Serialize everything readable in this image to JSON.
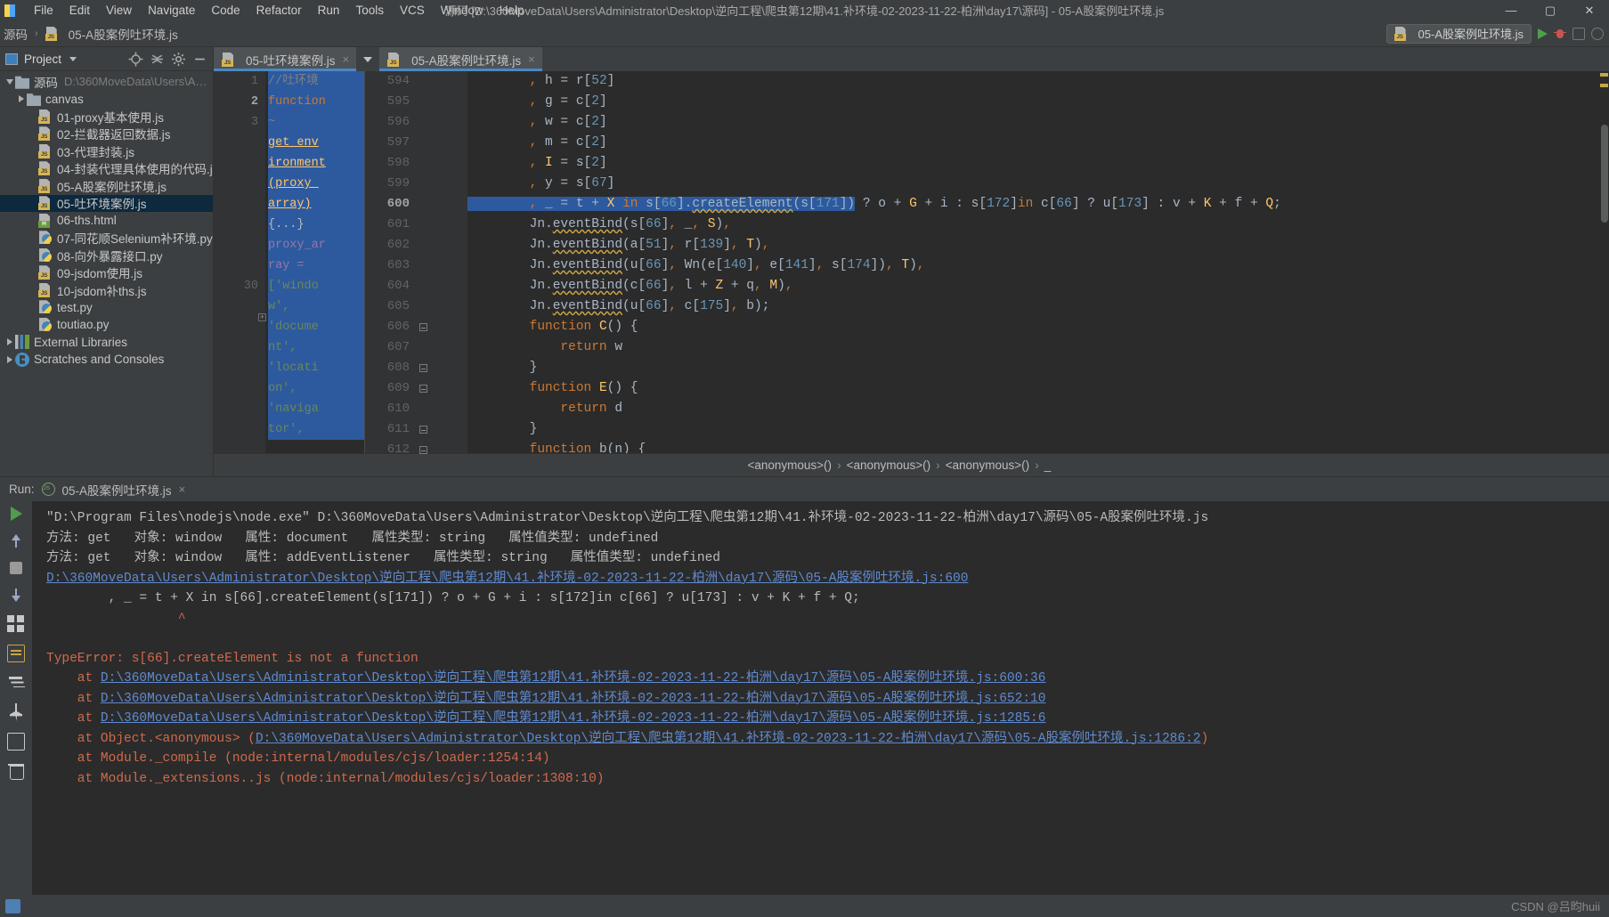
{
  "window": {
    "title": "源码 [D:\\360MoveData\\Users\\Administrator\\Desktop\\逆向工程\\爬虫第12期\\41.补环境-02-2023-11-22-柏洲\\day17\\源码] - 05-A股案例吐环境.js",
    "minimize": "—",
    "maximize": "▢",
    "close": "✕"
  },
  "menu": [
    "File",
    "Edit",
    "View",
    "Navigate",
    "Code",
    "Refactor",
    "Run",
    "Tools",
    "VCS",
    "Window",
    "Help"
  ],
  "breadcrumb": {
    "root": "源码",
    "separator": "›",
    "file": "05-A股案例吐环境.js"
  },
  "run_config": {
    "name": "05-A股案例吐环境.js",
    "run_icon": "run-icon",
    "debug_icon": "debug-icon",
    "coverage_icon": "coverage-icon",
    "profile_icon": "profile-icon"
  },
  "sidebar": {
    "title": "Project",
    "chevron": "▾",
    "toolbar_icons": [
      "locate-icon",
      "collapse-all-icon",
      "settings-gear-icon",
      "hide-icon"
    ],
    "tree": [
      {
        "label": "源码",
        "path": "D:\\360MoveData\\Users\\A…",
        "type": "folder",
        "depth": 0,
        "expanded": true,
        "selected": false
      },
      {
        "label": "canvas",
        "path": "",
        "type": "folder",
        "depth": 1,
        "expanded": false,
        "selected": false
      },
      {
        "label": "01-proxy基本使用.js",
        "path": "",
        "type": "js",
        "depth": 2,
        "expanded": null,
        "selected": false
      },
      {
        "label": "02-拦截器返回数据.js",
        "path": "",
        "type": "js",
        "depth": 2,
        "expanded": null,
        "selected": false
      },
      {
        "label": "03-代理封装.js",
        "path": "",
        "type": "js",
        "depth": 2,
        "expanded": null,
        "selected": false
      },
      {
        "label": "04-封装代理具体使用的代码.js",
        "path": "",
        "type": "js",
        "depth": 2,
        "expanded": null,
        "selected": false
      },
      {
        "label": "05-A股案例吐环境.js",
        "path": "",
        "type": "js",
        "depth": 2,
        "expanded": null,
        "selected": false
      },
      {
        "label": "05-吐环境案例.js",
        "path": "",
        "type": "js",
        "depth": 2,
        "expanded": null,
        "selected": true
      },
      {
        "label": "06-ths.html",
        "path": "",
        "type": "html",
        "depth": 2,
        "expanded": null,
        "selected": false
      },
      {
        "label": "07-同花顺Selenium补环境.py",
        "path": "",
        "type": "py",
        "depth": 2,
        "expanded": null,
        "selected": false
      },
      {
        "label": "08-向外暴露接口.py",
        "path": "",
        "type": "py",
        "depth": 2,
        "expanded": null,
        "selected": false
      },
      {
        "label": "09-jsdom使用.js",
        "path": "",
        "type": "js",
        "depth": 2,
        "expanded": null,
        "selected": false
      },
      {
        "label": "10-jsdom补ths.js",
        "path": "",
        "type": "js",
        "depth": 2,
        "expanded": null,
        "selected": false
      },
      {
        "label": "test.py",
        "path": "",
        "type": "py",
        "depth": 2,
        "expanded": null,
        "selected": false
      },
      {
        "label": "toutiao.py",
        "path": "",
        "type": "py",
        "depth": 2,
        "expanded": null,
        "selected": false
      },
      {
        "label": "External Libraries",
        "path": "",
        "type": "lib",
        "depth": 0,
        "expanded": false,
        "selected": false
      },
      {
        "label": "Scratches and Consoles",
        "path": "",
        "type": "scratch",
        "depth": 0,
        "expanded": false,
        "selected": false
      }
    ]
  },
  "editor_tabs": [
    {
      "label": "05-吐环境案例.js",
      "type": "js",
      "active": true,
      "close": "×"
    },
    {
      "label": "05-A股案例吐环境.js",
      "type": "js",
      "active": true,
      "close": "×"
    }
  ],
  "left_editor": {
    "line_numbers": [
      "1",
      "2",
      "3",
      "",
      "",
      "",
      "",
      "",
      "",
      "",
      "30",
      "",
      "",
      "",
      "",
      "",
      "",
      ""
    ],
    "lines": [
      "//吐环境",
      "function",
      "~",
      "get_env",
      "ironment",
      "(proxy_",
      "array)",
      "{...}",
      "proxy_ar",
      "ray =",
      "['windo",
      "w',",
      "'docume",
      "nt',",
      "'locati",
      "on',",
      "'naviga",
      "tor',"
    ]
  },
  "right_editor": {
    "lines": [
      {
        "num": "594",
        "text": ", h = r[52]"
      },
      {
        "num": "595",
        "text": ", g = c[2]"
      },
      {
        "num": "596",
        "text": ", w = c[2]"
      },
      {
        "num": "597",
        "text": ", m = c[2]"
      },
      {
        "num": "598",
        "text": ", I = s[2]"
      },
      {
        "num": "599",
        "text": ", y = s[67]"
      },
      {
        "num": "600",
        "text": ", _ = t + X in s[66].createElement(s[171]) ? o + G + i : s[172]in c[66] ? u[173] : v + K + f + Q;"
      },
      {
        "num": "601",
        "text": "Jn.eventBind(s[66], _, S),"
      },
      {
        "num": "602",
        "text": "Jn.eventBind(a[51], r[139], T),"
      },
      {
        "num": "603",
        "text": "Jn.eventBind(u[66], Wn(e[140], e[141], s[174]), T),"
      },
      {
        "num": "604",
        "text": "Jn.eventBind(c[66], l + Z + q, M),"
      },
      {
        "num": "605",
        "text": "Jn.eventBind(u[66], c[175], b);"
      },
      {
        "num": "606",
        "text": "function C() {"
      },
      {
        "num": "607",
        "text": "    return w"
      },
      {
        "num": "608",
        "text": "}"
      },
      {
        "num": "609",
        "text": "function E() {"
      },
      {
        "num": "610",
        "text": "    return d"
      },
      {
        "num": "611",
        "text": "}"
      },
      {
        "num": "612",
        "text": "function b(n) {"
      }
    ],
    "current_line": "600"
  },
  "editor_breadcrumb": {
    "items": [
      "<anonymous>()",
      "<anonymous>()",
      "<anonymous>()",
      "_"
    ],
    "separator": "›"
  },
  "run_panel": {
    "label": "Run:",
    "tab_name": "05-A股案例吐环境.js",
    "close": "×",
    "console_lines": [
      {
        "type": "plain",
        "text": "\"D:\\Program Files\\nodejs\\node.exe\" D:\\360MoveData\\Users\\Administrator\\Desktop\\逆向工程\\爬虫第12期\\41.补环境-02-2023-11-22-柏洲\\day17\\源码\\05-A股案例吐环境.js"
      },
      {
        "type": "plain",
        "text": "方法: get   对象: window   属性: document   属性类型: string   属性值类型: undefined"
      },
      {
        "type": "plain",
        "text": "方法: get   对象: window   属性: addEventListener   属性类型: string   属性值类型: undefined"
      },
      {
        "type": "link",
        "text": "D:\\360MoveData\\Users\\Administrator\\Desktop\\逆向工程\\爬虫第12期\\41.补环境-02-2023-11-22-柏洲\\day17\\源码\\05-A股案例吐环境.js:600"
      },
      {
        "type": "plain",
        "text": "        , _ = t + X in s[66].createElement(s[171]) ? o + G + i : s[172]in c[66] ? u[173] : v + K + f + Q;"
      },
      {
        "type": "caret",
        "text": "                 ^"
      },
      {
        "type": "blank",
        "text": ""
      },
      {
        "type": "error",
        "text": "TypeError: s[66].createElement is not a function"
      },
      {
        "type": "stack",
        "prefix": "    at ",
        "link": "D:\\360MoveData\\Users\\Administrator\\Desktop\\逆向工程\\爬虫第12期\\41.补环境-02-2023-11-22-柏洲\\day17\\源码\\05-A股案例吐环境.js:600:36",
        "suffix": ""
      },
      {
        "type": "stack",
        "prefix": "    at ",
        "link": "D:\\360MoveData\\Users\\Administrator\\Desktop\\逆向工程\\爬虫第12期\\41.补环境-02-2023-11-22-柏洲\\day17\\源码\\05-A股案例吐环境.js:652:10",
        "suffix": ""
      },
      {
        "type": "stack",
        "prefix": "    at ",
        "link": "D:\\360MoveData\\Users\\Administrator\\Desktop\\逆向工程\\爬虫第12期\\41.补环境-02-2023-11-22-柏洲\\day17\\源码\\05-A股案例吐环境.js:1285:6",
        "suffix": ""
      },
      {
        "type": "stack",
        "prefix": "    at Object.<anonymous> (",
        "link": "D:\\360MoveData\\Users\\Administrator\\Desktop\\逆向工程\\爬虫第12期\\41.补环境-02-2023-11-22-柏洲\\day17\\源码\\05-A股案例吐环境.js:1286:2",
        "suffix": ")"
      },
      {
        "type": "error",
        "text": "    at Module._compile (node:internal/modules/cjs/loader:1254:14)"
      },
      {
        "type": "error",
        "text": "    at Module._extensions..js (node:internal/modules/cjs/loader:1308:10)"
      }
    ],
    "tool_icons": [
      "rerun-icon",
      "stop-icon",
      "up-arrow-icon",
      "down-arrow-icon",
      "grid-icon",
      "soft-wrap-icon",
      "filter-icon",
      "pin-icon",
      "print-icon",
      "trash-icon"
    ]
  },
  "watermark": "CSDN @吕昀huii",
  "colors": {
    "accent": "#4a88c7",
    "selection": "#2d5a9e",
    "error": "#cf6a4c",
    "link": "#5f8ad0",
    "keyword": "#cc7832",
    "string": "#6a8759",
    "number": "#6897bb",
    "function": "#ffc66d",
    "editor_bg": "#2b2b2b",
    "chrome_bg": "#3c3f41"
  }
}
